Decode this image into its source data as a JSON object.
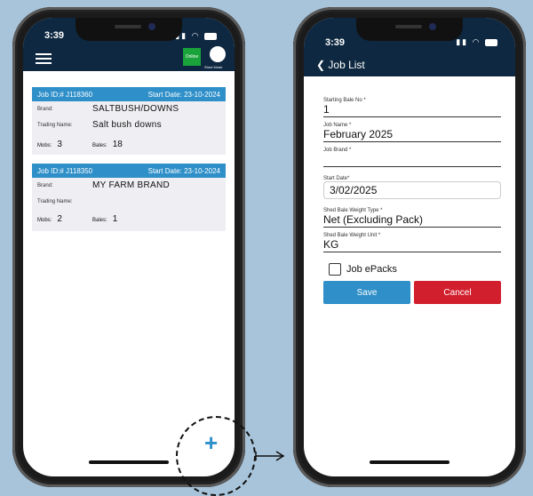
{
  "left_phone": {
    "time": "3:39",
    "status": {
      "online": "Online",
      "shed_mode": "Shed Mode"
    },
    "cards": [
      {
        "job_id": "Job ID:# J118360",
        "start": "Start Date: 23-10-2024",
        "brand_label": "Brand:",
        "brand": "SALTBUSH/DOWNS",
        "trading_label": "Trading Name:",
        "trading": "Salt bush downs",
        "mobs_label": "Mobs:",
        "mobs": "3",
        "bales_label": "Bales:",
        "bales": "18"
      },
      {
        "job_id": "Job ID:# J118350",
        "start": "Start Date: 23-10-2024",
        "brand_label": "Brand:",
        "brand": "MY FARM BRAND",
        "trading_label": "Trading Name:",
        "trading": "",
        "mobs_label": "Mobs:",
        "mobs": "2",
        "bales_label": "Bales:",
        "bales": "1"
      }
    ],
    "plus": "+"
  },
  "right_phone": {
    "time": "3:39",
    "back_label": "Job List",
    "form": {
      "starting_bale_label": "Starting Bale No *",
      "starting_bale_value": "1",
      "job_name_label": "Job Name *",
      "job_name_value": "February 2025",
      "job_brand_label": "Job Brand *",
      "job_brand_value": "",
      "start_date_label": "Start Date*",
      "start_date_value": "3/02/2025",
      "weight_type_label": "Shed Bale Weight Type *",
      "weight_type_value": "Net (Excluding Pack)",
      "weight_unit_label": "Shed Bale Weight Unit *",
      "weight_unit_value": "KG",
      "epacks_label": "Job ePacks",
      "save_label": "Save",
      "cancel_label": "Cancel"
    }
  },
  "colors": {
    "background": "#a8c4da",
    "header": "#0e2841",
    "accent": "#2e8fc9",
    "cancel": "#d21f2e",
    "online": "#1aa33a"
  }
}
